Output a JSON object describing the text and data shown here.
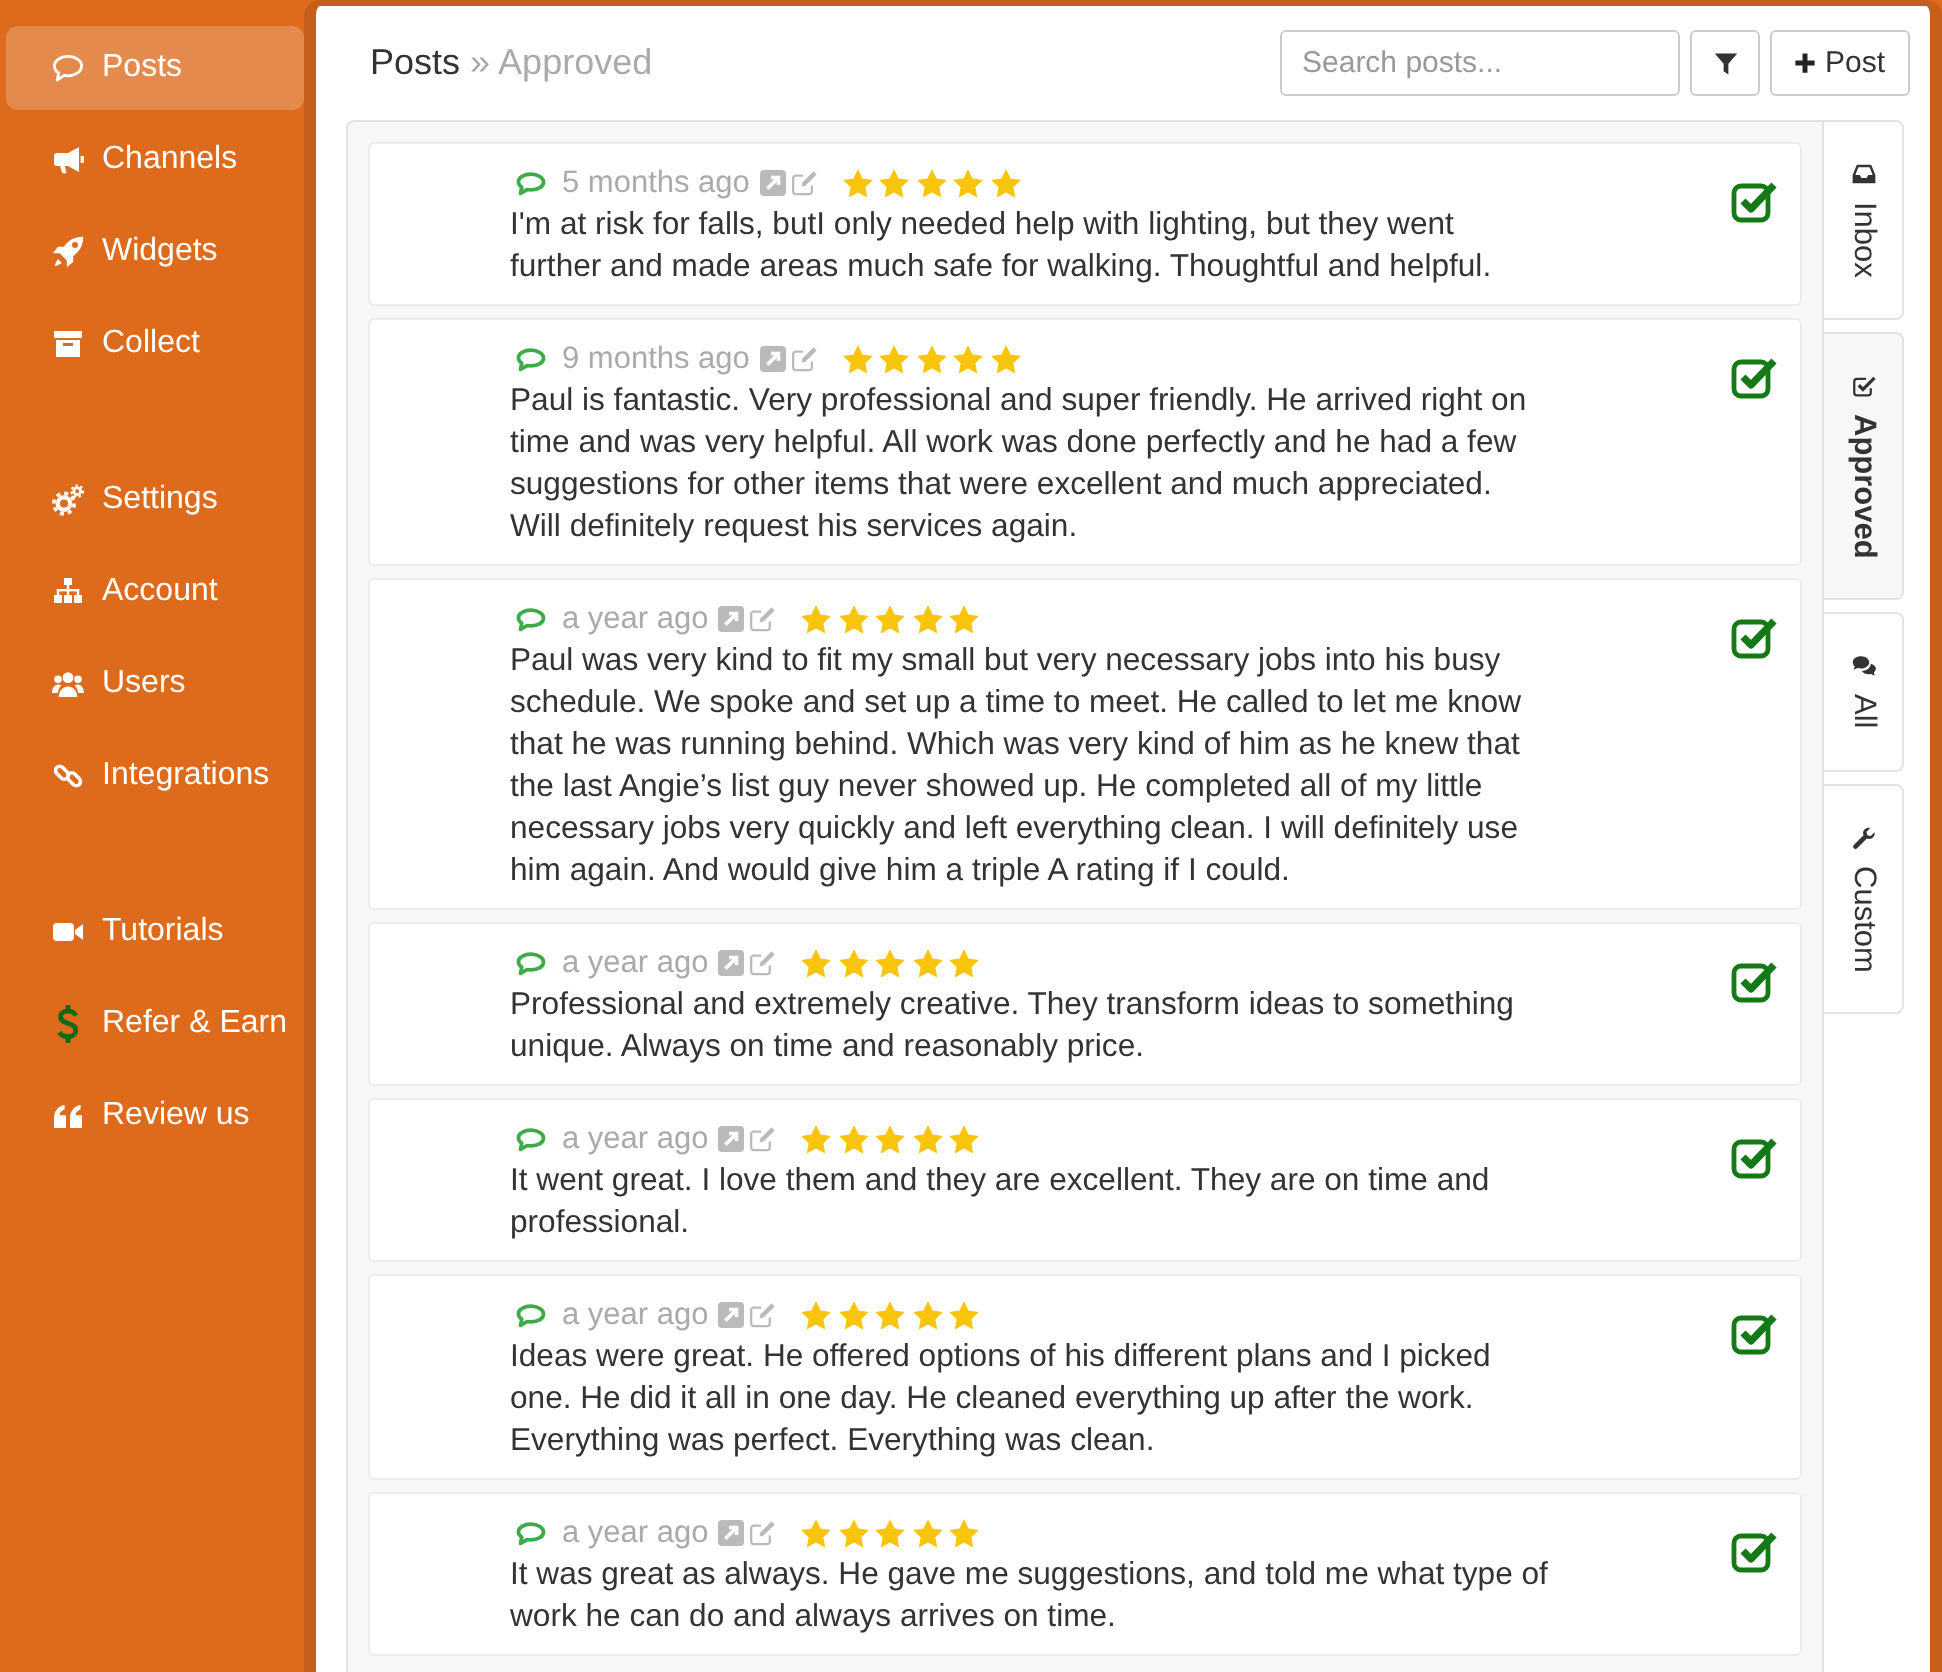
{
  "sidebar": {
    "groups": [
      {
        "items": [
          {
            "label": "Posts",
            "selected": true
          },
          {
            "label": "Channels",
            "selected": false
          },
          {
            "label": "Widgets",
            "selected": false
          },
          {
            "label": "Collect",
            "selected": false
          }
        ]
      },
      {
        "items": [
          {
            "label": "Settings",
            "selected": false
          },
          {
            "label": "Account",
            "selected": false
          },
          {
            "label": "Users",
            "selected": false
          },
          {
            "label": "Integrations",
            "selected": false
          }
        ]
      },
      {
        "items": [
          {
            "label": "Tutorials",
            "selected": false
          },
          {
            "label": "Refer & Earn",
            "selected": false
          },
          {
            "label": "Review us",
            "selected": false
          }
        ]
      }
    ]
  },
  "header": {
    "title": "Posts",
    "subtitle": "» Approved",
    "search": {
      "placeholder": "Search posts..."
    },
    "new_post_button": "Post"
  },
  "posts": [
    {
      "time": "5 months ago",
      "stars": 5,
      "approved": true,
      "text": "I'm at risk for falls, butI only needed help with lighting, but they went further and made areas much safe for walking. Thoughtful and helpful."
    },
    {
      "time": "9 months ago",
      "stars": 5,
      "approved": true,
      "text": "Paul is fantastic. Very professional and super friendly. He arrived right on time and was very helpful. All work was done perfectly and he had a few suggestions for other items that were excellent and much appreciated. Will definitely request his services again."
    },
    {
      "time": "a year ago",
      "stars": 5,
      "approved": true,
      "text": "Paul was very kind to fit my small but very necessary jobs into his busy schedule. We spoke and set up a time to meet. He called to let me know that he was running behind. Which was very kind of him as he knew that the last Angie’s list guy never showed up. He completed all of my little necessary jobs very quickly and left everything clean. I will definitely use him again. And would give him a triple A rating if I could."
    },
    {
      "time": "a year ago",
      "stars": 5,
      "approved": true,
      "text": "Professional and extremely creative. They transform ideas to something unique. Always on time and reasonably price."
    },
    {
      "time": "a year ago",
      "stars": 5,
      "approved": true,
      "text": "It went great. I love them and they are excellent. They are on time and professional."
    },
    {
      "time": "a year ago",
      "stars": 5,
      "approved": true,
      "text": "Ideas were great. He offered options of his different plans and I picked one. He did it all in one day. He cleaned everything up after the work. Everything was perfect. Everything was clean."
    },
    {
      "time": "a year ago",
      "stars": 5,
      "approved": true,
      "text": "It was great as always. He gave me suggestions, and told me what type of work he can do and always arrives on time."
    }
  ],
  "tabs": [
    {
      "label": "Inbox",
      "selected": false
    },
    {
      "label": "Approved",
      "selected": true
    },
    {
      "label": "All",
      "selected": false
    },
    {
      "label": "Custom",
      "selected": false
    }
  ]
}
